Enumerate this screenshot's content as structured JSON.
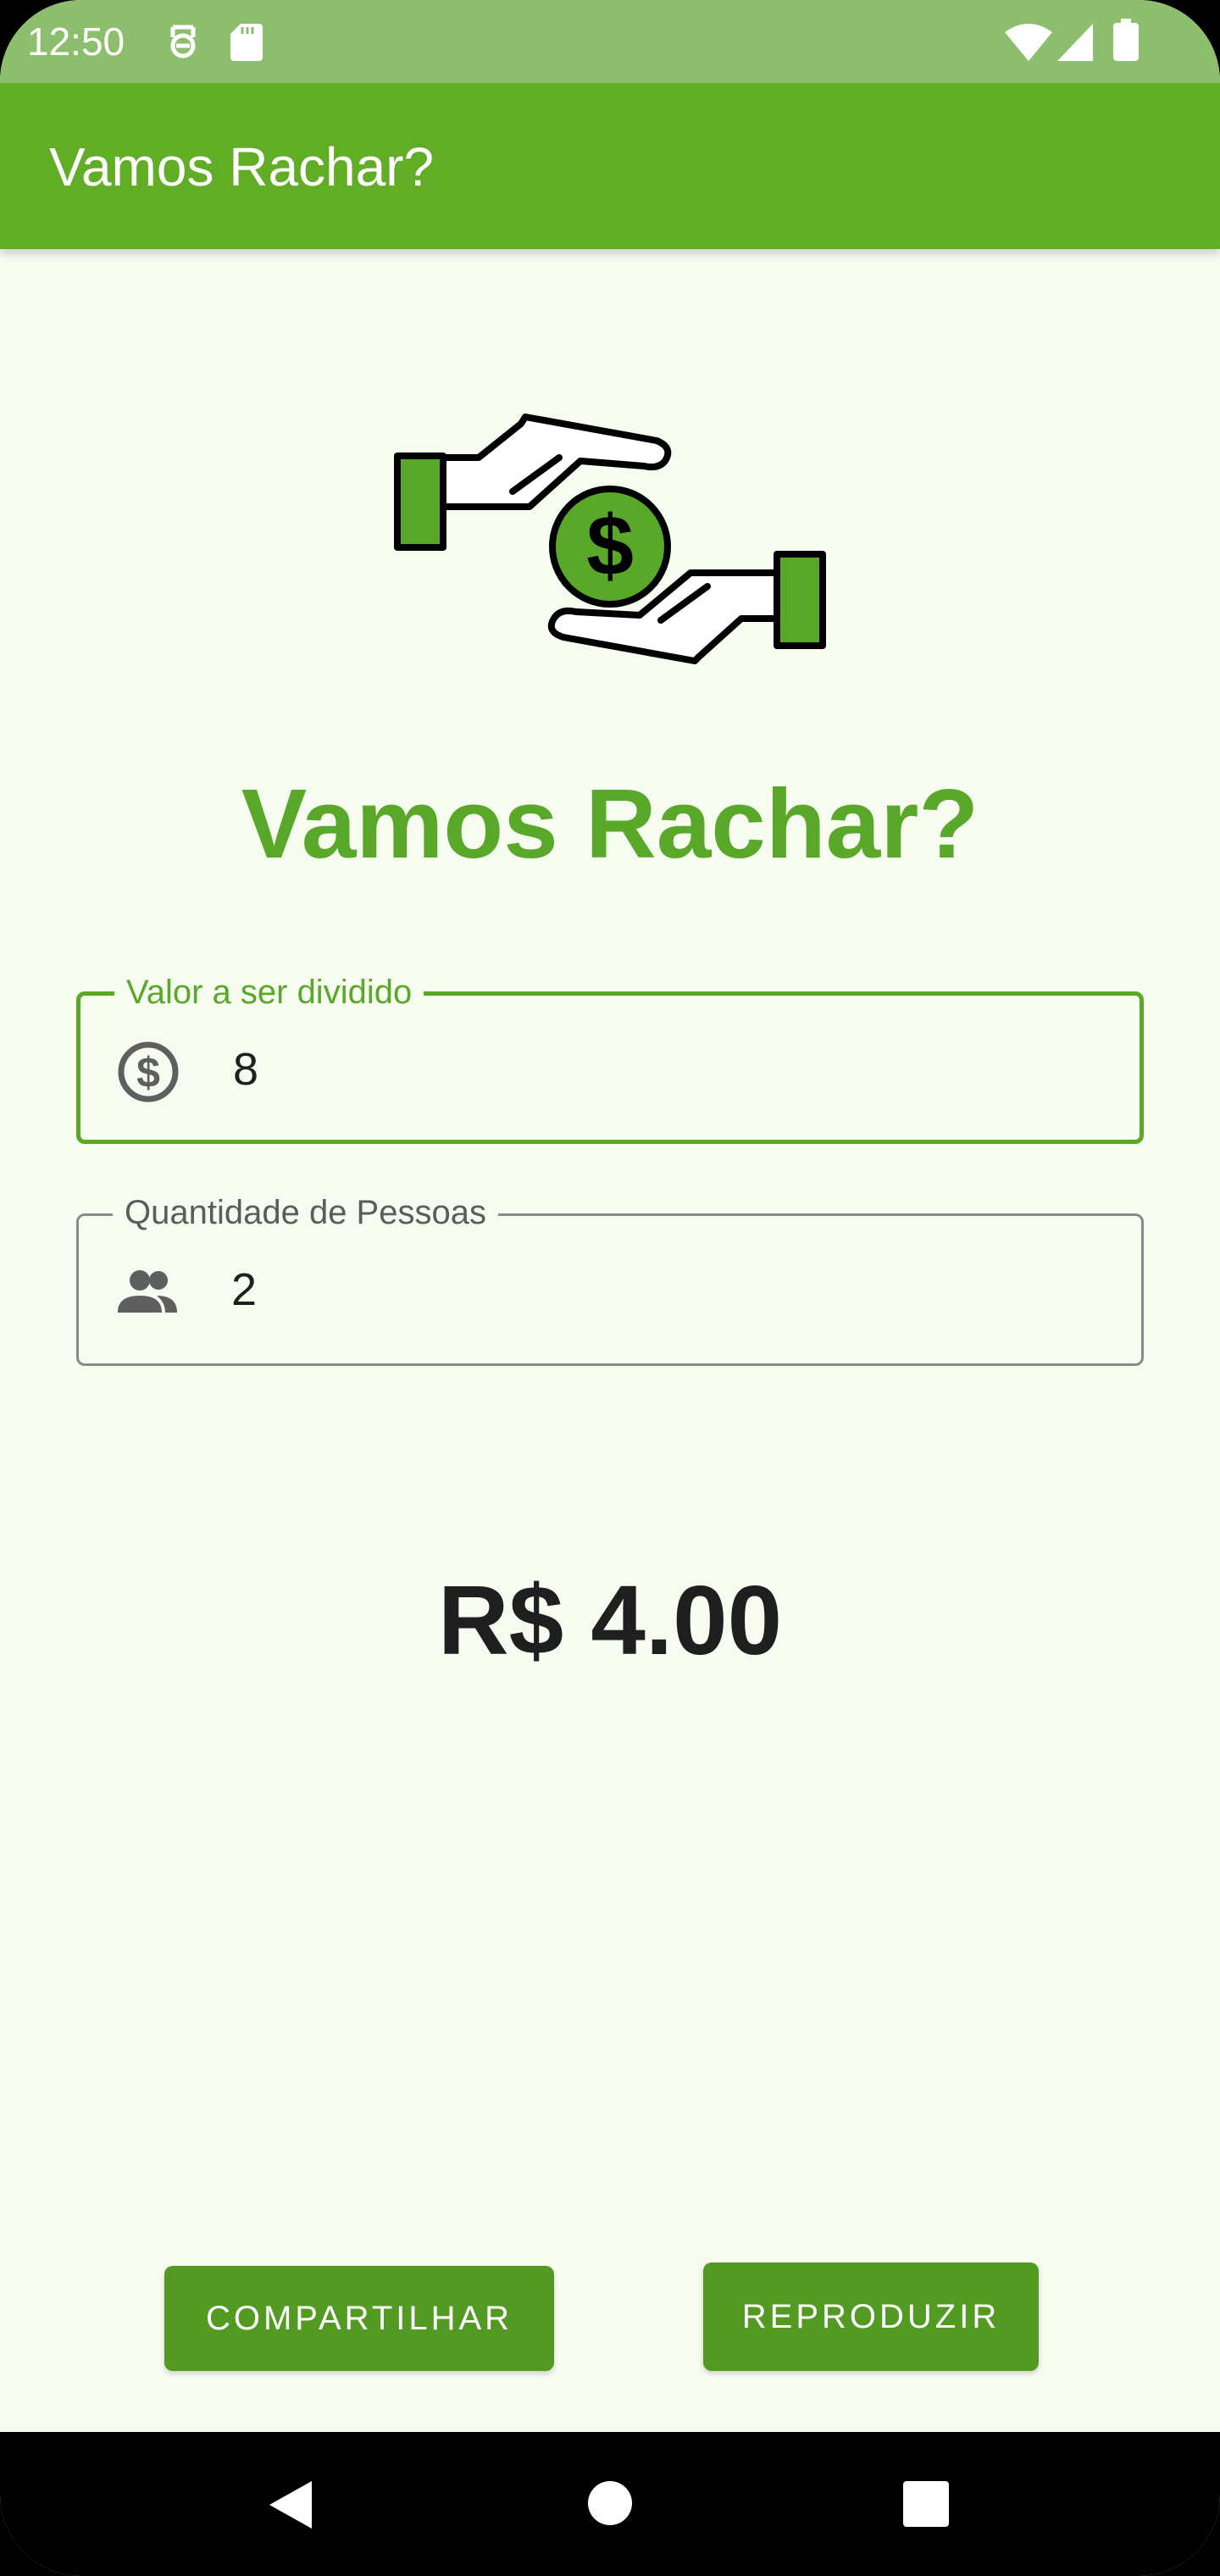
{
  "status_bar": {
    "time": "12:50",
    "icons": [
      "vpn-key-icon",
      "sd-card-icon",
      "wifi-icon",
      "cellular-signal-icon",
      "battery-icon"
    ]
  },
  "app_bar": {
    "title": "Vamos Rachar?"
  },
  "hero": {
    "icon": "hands-exchanging-money-icon"
  },
  "heading": "Vamos Rachar?",
  "form": {
    "amount": {
      "label": "Valor a ser dividido",
      "value": "8",
      "icon": "dollar-circle-icon"
    },
    "people": {
      "label": "Quantidade de Pessoas",
      "value": "2",
      "icon": "people-icon"
    }
  },
  "result": "R$ 4.00",
  "buttons": {
    "share": "COMPARTILHAR",
    "play": "REPRODUZIR"
  },
  "nav_bar": {
    "icons": [
      "back-icon",
      "home-icon",
      "recents-icon"
    ]
  },
  "colors": {
    "primary": "#61ad26",
    "heading": "#5aa82a",
    "button": "#539a23",
    "status_bar": "#8dbe6e",
    "background": "#f7fcf1"
  }
}
